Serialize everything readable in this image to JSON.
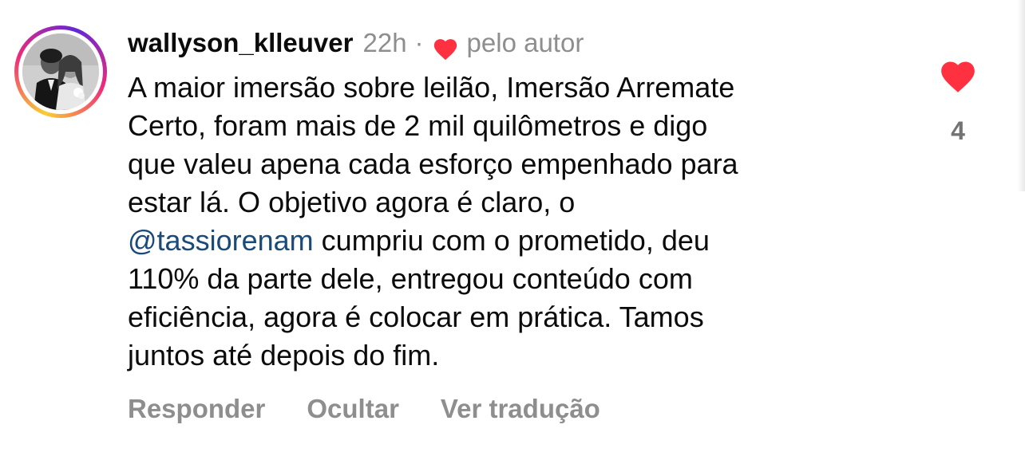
{
  "comment": {
    "username": "wallyson_klleuver",
    "time": "22h",
    "separator": "·",
    "author_label": "pelo autor",
    "text_lines": [
      "A maior imersão sobre leilão, Imersão Arremate",
      "Certo, foram mais de 2 mil quilômetros e digo",
      "que valeu apena cada esforço empenhado para",
      "estar lá. O objetivo agora é claro, o",
      "cumpriu com o prometido, deu",
      "110% da parte dele, entregou conteúdo com",
      "eficiência, agora é colocar em prática. Tamos",
      "juntos até depois do fim."
    ],
    "mention": "@tassiorenam",
    "like_count": "4"
  },
  "actions": {
    "reply": "Responder",
    "hide": "Ocultar",
    "translate": "Ver tradução"
  },
  "icons": {
    "author_heart": "heart-icon",
    "like": "heart-filled-icon"
  },
  "colors": {
    "like_red": "#ff3040",
    "secondary_text": "#8e8e8e",
    "mention": "#1a4a7a"
  }
}
